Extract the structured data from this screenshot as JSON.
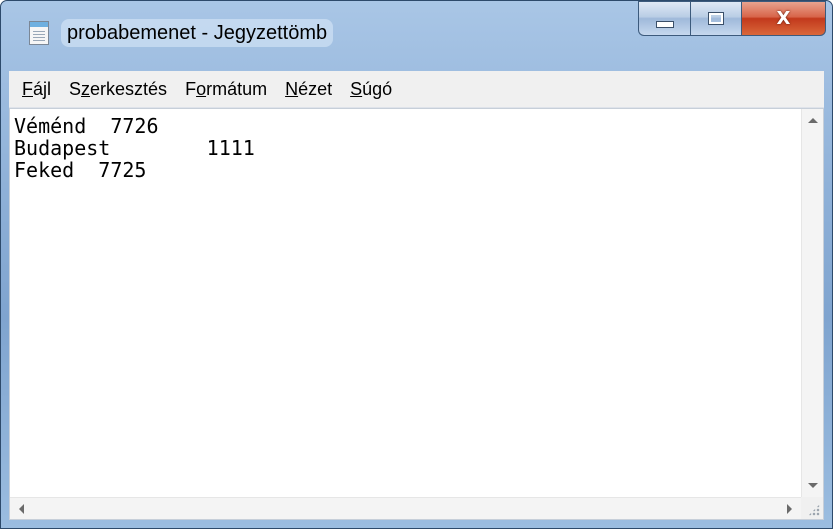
{
  "window": {
    "title": "probabemenet - Jegyzettömb",
    "icon": "notepad-icon",
    "controls": {
      "minimize_icon": "minimize-icon",
      "maximize_icon": "maximize-icon",
      "close_glyph": "X"
    }
  },
  "menu": {
    "items": [
      {
        "key": "F",
        "rest": "ájl"
      },
      {
        "pre": "S",
        "key": "z",
        "rest": "erkesztés"
      },
      {
        "pre": "F",
        "key": "o",
        "rest": "rmátum"
      },
      {
        "key": "N",
        "rest": "ézet"
      },
      {
        "key": "S",
        "rest": "úgó"
      }
    ]
  },
  "document": {
    "content": "Véménd  7726\nBudapest        1111\nFeked  7725"
  },
  "colors": {
    "title_bar": "#8fb1d8",
    "close_button": "#c2391c",
    "editor_bg": "#ffffff"
  }
}
